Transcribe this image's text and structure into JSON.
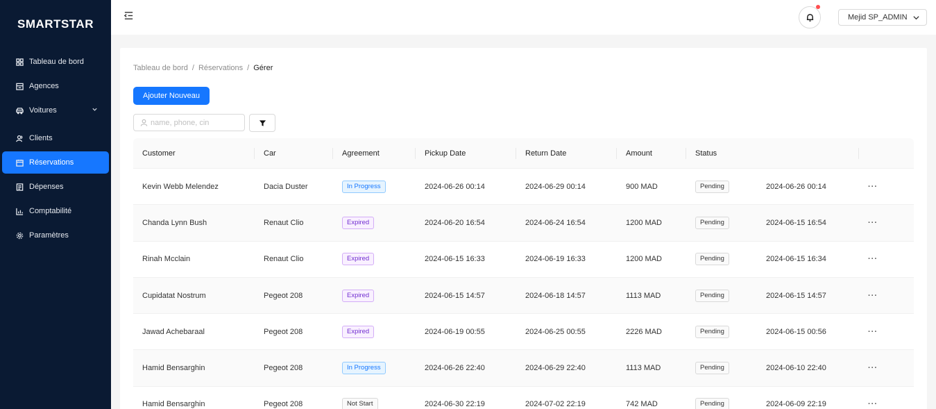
{
  "app": {
    "brand": "SMARTSTAR"
  },
  "sidebar": {
    "items": [
      {
        "label": "Tableau de bord",
        "icon": "dashboard-icon",
        "active": false
      },
      {
        "label": "Agences",
        "icon": "building-icon",
        "active": false
      },
      {
        "label": "Voitures",
        "icon": "car-icon",
        "active": false,
        "expandable": true
      },
      {
        "label": "Clients",
        "icon": "users-icon",
        "active": false
      },
      {
        "label": "Réservations",
        "icon": "calendar-icon",
        "active": true
      },
      {
        "label": "Dépenses",
        "icon": "receipt-icon",
        "active": false
      },
      {
        "label": "Comptabilité",
        "icon": "chart-icon",
        "active": false
      },
      {
        "label": "Paramètres",
        "icon": "settings-icon",
        "active": false
      }
    ]
  },
  "header": {
    "user_label": "Mejid SP_ADMIN",
    "has_notification": true
  },
  "breadcrumb": [
    "Tableau de bord",
    "Réservations",
    "Gérer"
  ],
  "actions": {
    "add_label": "Ajouter Nouveau",
    "search_placeholder": "name, phone, cin"
  },
  "table": {
    "columns": [
      "Customer",
      "Car",
      "Agreement",
      "Pickup Date",
      "Return Date",
      "Amount",
      "Status"
    ],
    "rows": [
      {
        "customer": "Kevin Webb Melendez",
        "car": "Dacia Duster",
        "agreement": "In Progress",
        "agreement_type": "progress",
        "pickup": "2024-06-26 00:14",
        "return": "2024-06-29 00:14",
        "amount": "900 MAD",
        "status": "Pending",
        "created": "2024-06-26 00:14",
        "more": "···"
      },
      {
        "customer": "Chanda Lynn Bush",
        "car": "Renaut Clio",
        "agreement": "Expired",
        "agreement_type": "expired",
        "pickup": "2024-06-20 16:54",
        "return": "2024-06-24 16:54",
        "amount": "1200 MAD",
        "status": "Pending",
        "created": "2024-06-15 16:54",
        "more": "···"
      },
      {
        "customer": "Rinah Mcclain",
        "car": "Renaut Clio",
        "agreement": "Expired",
        "agreement_type": "expired",
        "pickup": "2024-06-15 16:33",
        "return": "2024-06-19 16:33",
        "amount": "1200 MAD",
        "status": "Pending",
        "created": "2024-06-15 16:34",
        "more": "···"
      },
      {
        "customer": "Cupidatat Nostrum",
        "car": "Pegeot 208",
        "agreement": "Expired",
        "agreement_type": "expired",
        "pickup": "2024-06-15 14:57",
        "return": "2024-06-18 14:57",
        "amount": "1113 MAD",
        "status": "Pending",
        "created": "2024-06-15 14:57",
        "more": "···"
      },
      {
        "customer": "Jawad Achebaraal",
        "car": "Pegeot 208",
        "agreement": "Expired",
        "agreement_type": "expired",
        "pickup": "2024-06-19 00:55",
        "return": "2024-06-25 00:55",
        "amount": "2226 MAD",
        "status": "Pending",
        "created": "2024-06-15 00:56",
        "more": "···"
      },
      {
        "customer": "Hamid Bensarghin",
        "car": "Pegeot 208",
        "agreement": "In Progress",
        "agreement_type": "progress",
        "pickup": "2024-06-26 22:40",
        "return": "2024-06-29 22:40",
        "amount": "1113 MAD",
        "status": "Pending",
        "created": "2024-06-10 22:40",
        "more": "···"
      },
      {
        "customer": "Hamid Bensarghin",
        "car": "Pegeot 208",
        "agreement": "Not Start",
        "agreement_type": "notstart",
        "pickup": "2024-06-30 22:19",
        "return": "2024-07-02 22:19",
        "amount": "742 MAD",
        "status": "Pending",
        "created": "2024-06-09 22:19",
        "more": "···"
      }
    ]
  },
  "colors": {
    "sidebar_bg": "#0a1a33",
    "accent": "#1677ff",
    "notification": "#ff4d4f"
  }
}
